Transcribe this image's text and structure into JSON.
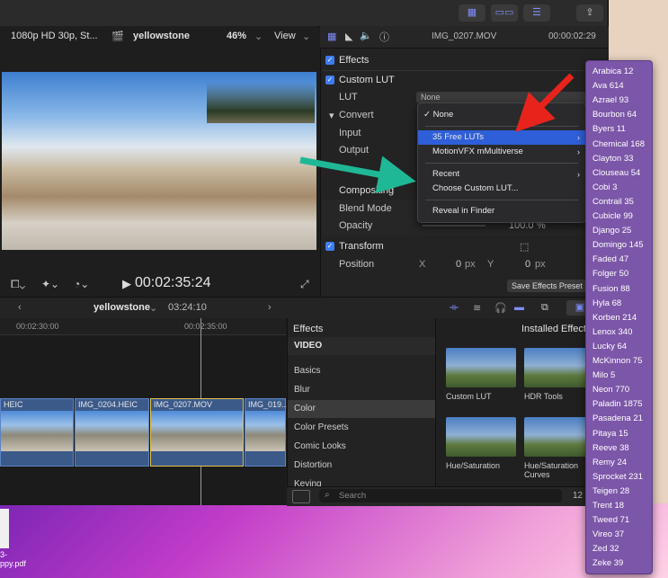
{
  "toolbar": {
    "share_icon": "share-icon"
  },
  "viewer": {
    "format": "1080p HD 30p, St...",
    "project": "yellowstone",
    "zoom": "46%",
    "view": "View",
    "timecode": "00:02:35:24"
  },
  "inspector": {
    "clip_name": "IMG_0207.MOV",
    "clip_time": "00:00:02:29",
    "effects_label": "Effects",
    "custom_lut_label": "Custom LUT",
    "lut_label": "LUT",
    "lut_value": "None",
    "convert_label": "Convert",
    "input_label": "Input",
    "output_label": "Output",
    "compositing_label": "Compositing",
    "blend_mode_label": "Blend Mode",
    "opacity_label": "Opacity",
    "opacity_value": "100.0",
    "opacity_unit": "%",
    "transform_label": "Transform",
    "position_label": "Position",
    "x_label": "X",
    "x_value": "0",
    "y_label": "Y",
    "y_value": "0",
    "px": "px",
    "save_button": "Save Effects Preset"
  },
  "lut_menu": {
    "none": "None",
    "free_luts": "35 Free LUTs",
    "motionvfx": "MotionVFX mMultiverse",
    "recent": "Recent",
    "choose": "Choose Custom LUT...",
    "reveal": "Reveal in Finder"
  },
  "timeline": {
    "project": "yellowstone",
    "duration": "03:24:10",
    "ruler_a": "00:02:30:00",
    "ruler_b": "00:02:35:00",
    "clips": [
      "HEIC",
      "IMG_0204.HEIC",
      "IMG_0207.MOV",
      "IMG_019..."
    ]
  },
  "effects_browser": {
    "title": "Effects",
    "installed": "Installed Effects",
    "categories": [
      "VIDEO",
      "Basics",
      "Blur",
      "Color",
      "Color Presets",
      "Comic Looks",
      "Distortion",
      "Keying"
    ],
    "items": [
      "Custom LUT",
      "HDR Tools",
      "Hue/Saturation",
      "Hue/Saturation Curves"
    ],
    "search_placeholder": "Search",
    "count": "12"
  },
  "lut_list": [
    "Arabica 12",
    "Ava 614",
    "Azrael 93",
    "Bourbon 64",
    "Byers 11",
    "Chemical 168",
    "Clayton 33",
    "Clouseau 54",
    "Cobi 3",
    "Contrail 35",
    "Cubicle 99",
    "Django 25",
    "Domingo 145",
    "Faded 47",
    "Folger 50",
    "Fusion 88",
    "Hyla 68",
    "Korben 214",
    "Lenox 340",
    "Lucky 64",
    "McKinnon 75",
    "Milo 5",
    "Neon 770",
    "Paladin 1875",
    "Pasadena 21",
    "Pitaya 15",
    "Reeve 38",
    "Remy 24",
    "Sprocket 231",
    "Teigen 28",
    "Trent 18",
    "Tweed 71",
    "Vireo 37",
    "Zed 32",
    "Zeke 39"
  ],
  "desktop": {
    "file_label_1": "3-",
    "file_label_2": "ppy.pdf"
  },
  "colors": {
    "accent": "#2f5fd8",
    "arrow_red": "#e8231c",
    "arrow_teal": "#1fb896",
    "lut_panel": "#7c56a8"
  }
}
